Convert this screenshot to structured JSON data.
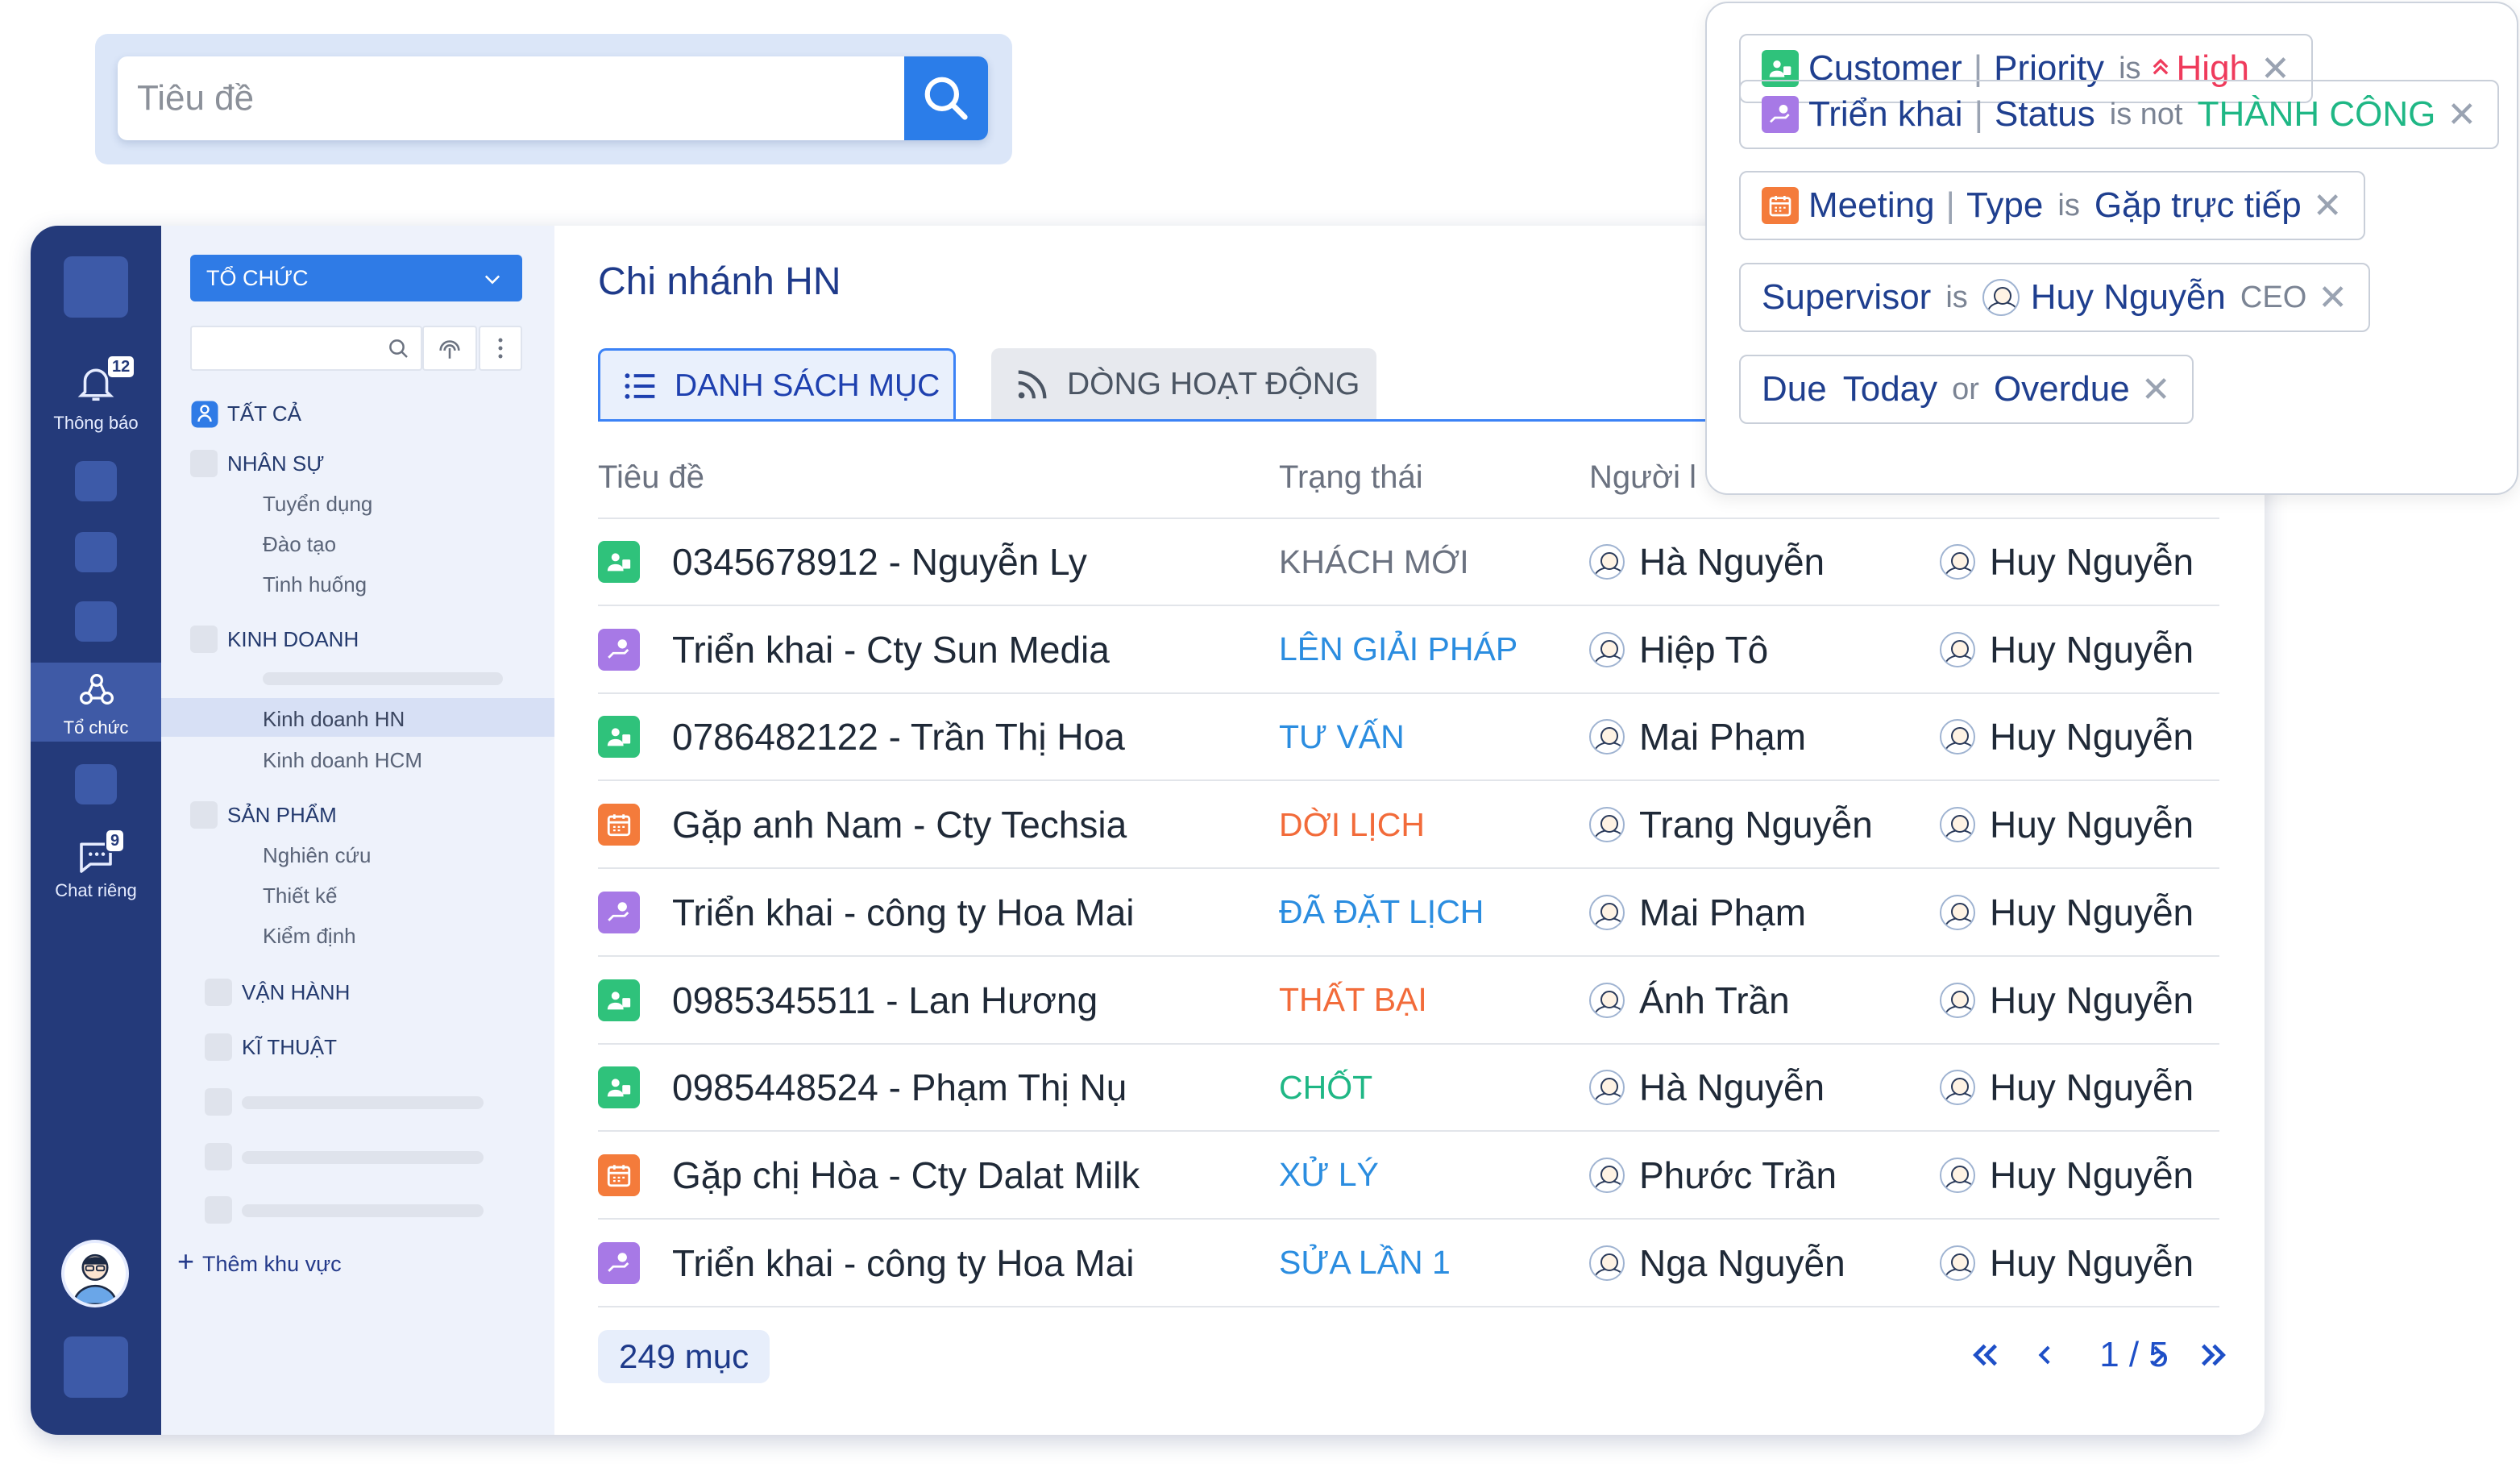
{
  "search": {
    "placeholder": "Tiêu đề"
  },
  "rail": {
    "notifications_label": "Thông báo",
    "notifications_badge": "12",
    "org_label": "Tổ chức",
    "chat_label": "Chat riêng",
    "chat_badge": "9"
  },
  "panel": {
    "org_select": "TỔ CHỨC",
    "all": "TẤT CẢ",
    "groups": [
      {
        "label": "NHÂN SỰ",
        "items": [
          "Tuyển dụng",
          "Đào tạo",
          "Tinh huống"
        ]
      },
      {
        "label": "KINH DOANH",
        "items": [
          "Kinh doanh HN",
          "Kinh doanh HCM"
        ]
      },
      {
        "label": "SẢN PHẨM",
        "items": [
          "Nghiên cứu",
          "Thiết kế",
          "Kiểm định"
        ]
      },
      {
        "label": "VẬN HÀNH",
        "items": []
      },
      {
        "label": "KĨ THUẬT",
        "items": []
      }
    ],
    "add_area": "Thêm khu vực"
  },
  "main": {
    "title": "Chi nhánh HN",
    "tabs": [
      {
        "label": "DANH SÁCH MỤC",
        "active": true
      },
      {
        "label": "DÒNG HOẠT ĐỘNG",
        "active": false
      }
    ],
    "columns": [
      "Tiêu đề",
      "Trạng thái",
      "Người l"
    ],
    "rows": [
      {
        "type": "customer",
        "title": "0345678912 - Nguyễn Ly",
        "status": "KHÁCH MỚI",
        "status_color": "#6b7280",
        "p1": "Hà Nguyễn",
        "p2": "Huy Nguyễn"
      },
      {
        "type": "deploy",
        "title": "Triển khai - Cty Sun Media",
        "status": "LÊN GIẢI PHÁP",
        "status_color": "#2b8de0",
        "p1": "Hiệp Tô",
        "p2": "Huy Nguyễn"
      },
      {
        "type": "customer",
        "title": "0786482122 - Trần Thị Hoa",
        "status": "TƯ VẤN",
        "status_color": "#2b8de0",
        "p1": "Mai Phạm",
        "p2": "Huy Nguyễn"
      },
      {
        "type": "meeting",
        "title": "Gặp anh Nam - Cty Techsia",
        "status": "DỜI LỊCH",
        "status_color": "#f26b3a",
        "p1": "Trang Nguyễn",
        "p2": "Huy Nguyễn"
      },
      {
        "type": "deploy",
        "title": "Triển khai - công ty Hoa Mai",
        "status": "ĐÃ ĐẶT LỊCH",
        "status_color": "#2b8de0",
        "p1": "Mai Phạm",
        "p2": "Huy Nguyễn"
      },
      {
        "type": "customer",
        "title": "0985345511 - Lan Hương",
        "status": "THẤT BẠI",
        "status_color": "#f26b3a",
        "p1": "Ánh Trần",
        "p2": "Huy Nguyễn"
      },
      {
        "type": "customer",
        "title": "0985448524 - Phạm Thị Nụ",
        "status": "CHỐT",
        "status_color": "#1fb785",
        "p1": "Hà Nguyễn",
        "p2": "Huy Nguyễn"
      },
      {
        "type": "meeting",
        "title": "Gặp chị Hòa - Cty Dalat Milk",
        "status": "XỬ LÝ",
        "status_color": "#2b8de0",
        "p1": "Phước Trần",
        "p2": "Huy Nguyễn"
      },
      {
        "type": "deploy",
        "title": "Triển khai - công ty Hoa Mai",
        "status": "SỬA LẦN 1",
        "status_color": "#2b8de0",
        "p1": "Nga Nguyễn",
        "p2": "Huy Nguyễn"
      }
    ],
    "count": "249 mục",
    "pager": {
      "first": "«",
      "prev": "‹",
      "page": "1 / 5",
      "next": "›",
      "last": "»"
    }
  },
  "filters": [
    {
      "icon": "customer",
      "field": "Customer",
      "sub": "Priority",
      "op": "is",
      "value": "High",
      "value_color": "#ef3b5c"
    },
    {
      "icon": "deploy",
      "field": "Triển khai",
      "sub": "Status",
      "op": "is not",
      "value": "THÀNH CÔNG",
      "value_color": "#1fb785"
    },
    {
      "icon": "meeting",
      "field": "Meeting",
      "sub": "Type",
      "op": "is",
      "value": "Gặp trực tiếp",
      "value_color": "#1f3f8f"
    },
    {
      "field": "Supervisor",
      "op": "is",
      "value": "Huy Nguyễn",
      "extra": "CEO"
    },
    {
      "field": "Due",
      "value": "Today",
      "op": "or",
      "value2": "Overdue"
    }
  ],
  "colors": {
    "rail": "#243a7a",
    "accent": "#2f7be6",
    "customer_icon": "#2fc27b",
    "deploy_icon": "#a779e6",
    "meeting_icon": "#f47b3b"
  }
}
